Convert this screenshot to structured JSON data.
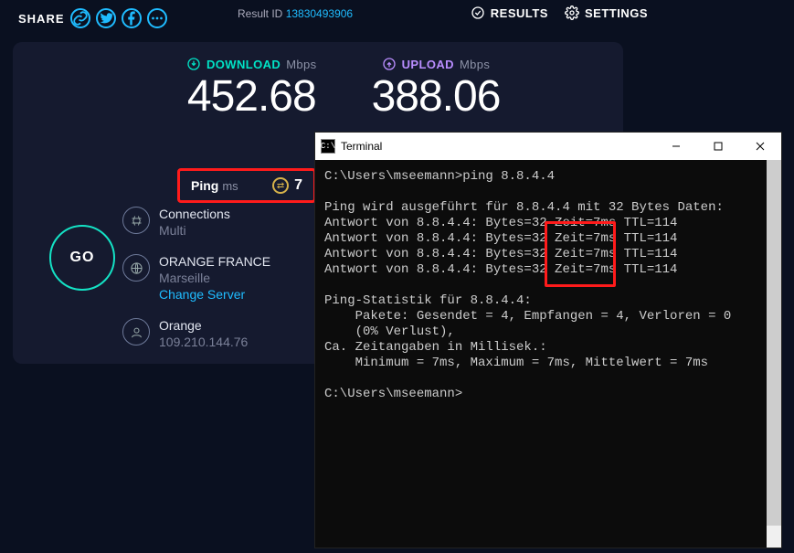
{
  "topbar": {
    "share_label": "SHARE",
    "resultid_label": "Result ID ",
    "resultid_value": "13830493906",
    "results_label": "RESULTS",
    "settings_label": "SETTINGS"
  },
  "speeds": {
    "download_label": "DOWNLOAD",
    "download_unit": "Mbps",
    "download_value": "452.68",
    "upload_label": "UPLOAD",
    "upload_unit": "Mbps",
    "upload_value": "388.06"
  },
  "ping": {
    "label": "Ping",
    "unit": "ms",
    "value": "7"
  },
  "go_label": "GO",
  "meta": {
    "connections": {
      "title": "Connections",
      "value": "Multi"
    },
    "server": {
      "title": "ORANGE FRANCE",
      "loc": "Marseille",
      "change": "Change Server"
    },
    "isp": {
      "title": "Orange",
      "ip": "109.210.144.76"
    }
  },
  "terminal": {
    "title": "Terminal",
    "lines": [
      "C:\\Users\\mseemann>ping 8.8.4.4",
      "",
      "Ping wird ausgeführt für 8.8.4.4 mit 32 Bytes Daten:",
      "Antwort von 8.8.4.4: Bytes=32 Zeit=7ms TTL=114",
      "Antwort von 8.8.4.4: Bytes=32 Zeit=7ms TTL=114",
      "Antwort von 8.8.4.4: Bytes=32 Zeit=7ms TTL=114",
      "Antwort von 8.8.4.4: Bytes=32 Zeit=7ms TTL=114",
      "",
      "Ping-Statistik für 8.8.4.4:",
      "    Pakete: Gesendet = 4, Empfangen = 4, Verloren = 0",
      "    (0% Verlust),",
      "Ca. Zeitangaben in Millisek.:",
      "    Minimum = 7ms, Maximum = 7ms, Mittelwert = 7ms",
      "",
      "C:\\Users\\mseemann>"
    ]
  }
}
